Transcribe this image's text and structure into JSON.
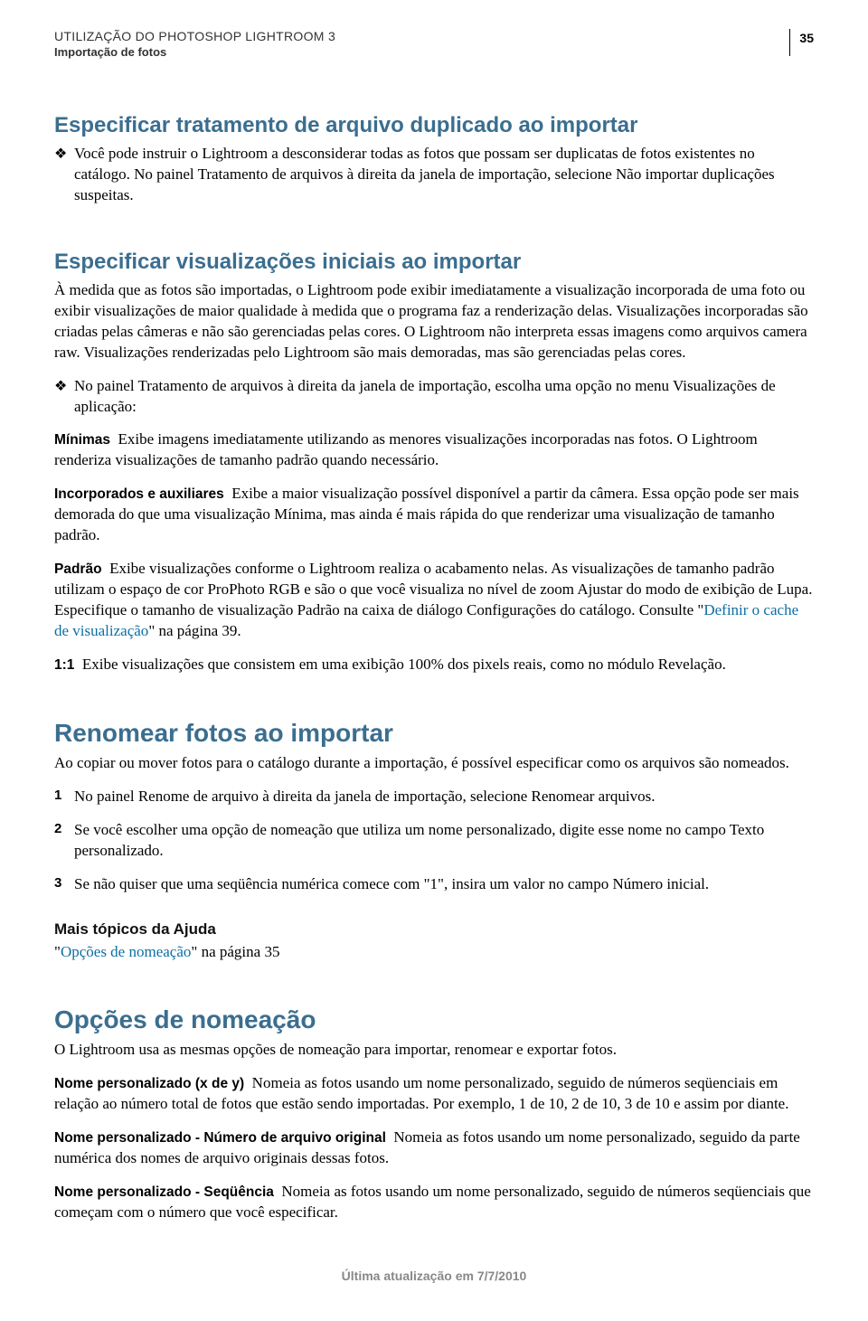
{
  "header": {
    "title": "UTILIZAÇÃO DO PHOTOSHOP LIGHTROOM 3",
    "subtitle": "Importação de fotos",
    "page_number": "35"
  },
  "sec1": {
    "heading": "Especificar tratamento de arquivo duplicado ao importar",
    "bullet": "Você pode instruir o Lightroom a desconsiderar todas as fotos que possam ser duplicatas de fotos existentes no catálogo. No painel Tratamento de arquivos à direita da janela de importação, selecione Não importar duplicações suspeitas."
  },
  "sec2": {
    "heading": "Especificar visualizações iniciais ao importar",
    "p1": "À medida que as fotos são importadas, o Lightroom pode exibir imediatamente a visualização incorporada de uma foto ou exibir visualizações de maior qualidade à medida que o programa faz a renderização delas. Visualizações incorporadas são criadas pelas câmeras e não são gerenciadas pelas cores. O Lightroom não interpreta essas imagens como arquivos camera raw. Visualizações renderizadas pelo Lightroom são mais demoradas, mas são gerenciadas pelas cores.",
    "bullet": "No painel Tratamento de arquivos à direita da janela de importação, escolha uma opção no menu Visualizações de aplicação:",
    "def_min_term": "Mínimas",
    "def_min_body": "Exibe imagens imediatamente utilizando as menores visualizações incorporadas nas fotos. O Lightroom renderiza visualizações de tamanho padrão quando necessário.",
    "def_inc_term": "Incorporados e auxiliares",
    "def_inc_body": "Exibe a maior visualização possível disponível a partir da câmera. Essa opção pode ser mais demorada do que uma visualização Mínima, mas ainda é mais rápida do que renderizar uma visualização de tamanho padrão.",
    "def_pad_term": "Padrão",
    "def_pad_body_a": "Exibe visualizações conforme o Lightroom realiza o acabamento nelas. As visualizações de tamanho padrão utilizam o espaço de cor ProPhoto RGB e são o que você visualiza no nível de zoom Ajustar do modo de exibição de Lupa. Especifique o tamanho de visualização Padrão na caixa de diálogo Configurações do catálogo. Consulte \"",
    "def_pad_link": "Definir o cache de visualização",
    "def_pad_body_b": "\" na página 39.",
    "def_11_term": "1:1",
    "def_11_body": "Exibe visualizações que consistem em uma exibição 100% dos pixels reais, como no módulo Revelação."
  },
  "sec3": {
    "heading": "Renomear fotos ao importar",
    "p1": "Ao copiar ou mover fotos para o catálogo durante a importação, é possível especificar como os arquivos são nomeados.",
    "step1": "No painel Renome de arquivo à direita da janela de importação, selecione Renomear arquivos.",
    "step2": "Se você escolher uma opção de nomeação que utiliza um nome personalizado, digite esse nome no campo Texto personalizado.",
    "step3": "Se não quiser que uma seqüência numérica comece com \"1\", insira um valor no campo Número inicial.",
    "more_heading": "Mais tópicos da Ajuda",
    "more_link_a": "\"",
    "more_link": "Opções de nomeação",
    "more_link_b": "\" na página 35"
  },
  "sec4": {
    "heading": "Opções de nomeação",
    "p1": "O Lightroom usa as mesmas opções de nomeação para importar, renomear e exportar fotos.",
    "d1_term": "Nome personalizado (x de y)",
    "d1_body": "Nomeia as fotos usando um nome personalizado, seguido de números seqüenciais em relação ao número total de fotos que estão sendo importadas. Por exemplo, 1 de 10, 2 de 10, 3 de 10 e assim por diante.",
    "d2_term": "Nome personalizado - Número de arquivo original",
    "d2_body": "Nomeia as fotos usando um nome personalizado, seguido da parte numérica dos nomes de arquivo originais dessas fotos.",
    "d3_term": "Nome personalizado - Seqüência",
    "d3_body": "Nomeia as fotos usando um nome personalizado, seguido de números seqüenciais que começam com o número que você especificar."
  },
  "footer": "Última atualização em 7/7/2010"
}
